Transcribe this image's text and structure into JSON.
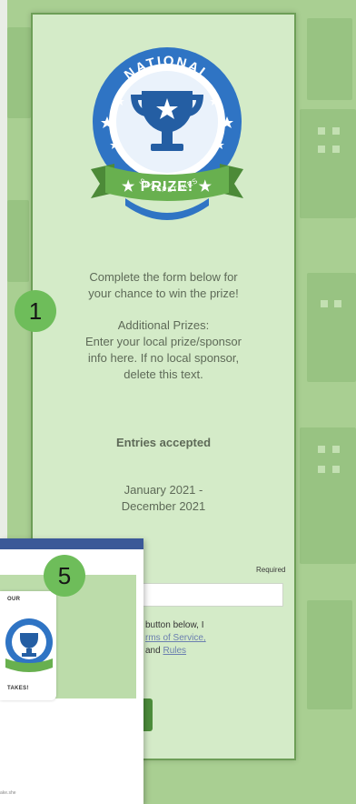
{
  "emblem": {
    "arc_top": "NATIONAL",
    "ribbon": "★ PRIZE! ★",
    "arc_bottom": "SWEEPSTAKES",
    "colors": {
      "ring": "#2f74c4",
      "ring_dark": "#245ea3",
      "ribbon": "#68b04f",
      "ribbon_dark": "#4c8a38",
      "white": "#ffffff"
    },
    "icons": [
      "trophy-icon",
      "star-icon"
    ]
  },
  "content": {
    "intro_line1": "Complete the form below for",
    "intro_line2": "your chance to win the prize!",
    "additional_title": "Additional Prizes:",
    "additional_line1": "Enter your local prize/sponsor",
    "additional_line2": "info here. If no local sponsor,",
    "additional_line3": "delete this text.",
    "entries_label": "Entries accepted",
    "dates_line1": "January 2021 -",
    "dates_line2": "December 2021"
  },
  "form": {
    "required_label": "Required",
    "consent_line1": "button below, I",
    "consent_link1": "rms of Service,",
    "consent_and": "and",
    "consent_link2": "Rules"
  },
  "badges": {
    "one": "1",
    "five": "5"
  },
  "preview": {
    "card_top_label": "OUR",
    "card_bottom_label": "TAKES!",
    "footer_text": "ake.she"
  },
  "colors": {
    "backdrop": "#a9cf92",
    "panel": "#d4ebc8",
    "badge": "#6ebd5a",
    "facebook_bar": "#3b5998",
    "button": "#4c8d3b"
  }
}
